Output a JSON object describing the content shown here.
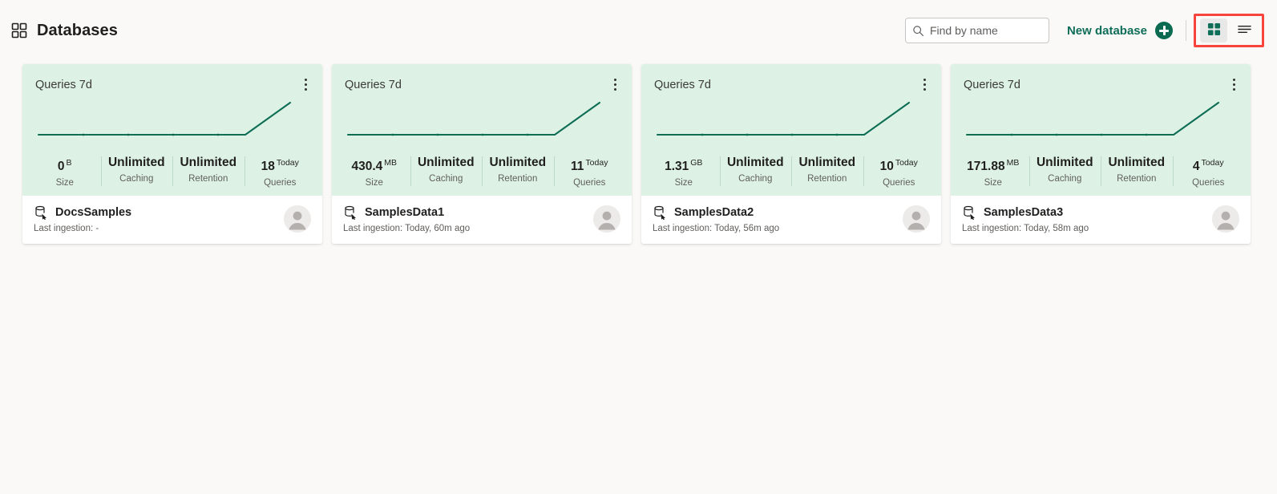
{
  "header": {
    "title": "Databases",
    "title_icon": "grid-squares-icon",
    "search": {
      "icon": "search-icon",
      "placeholder": "Find by name",
      "value": ""
    },
    "new_database": {
      "label": "New database",
      "icon": "plus-circle-icon"
    },
    "view_toggle": {
      "highlighted": true,
      "highlight_color": "#f8443c",
      "options": [
        {
          "name": "grid-view",
          "icon": "grid-view-icon",
          "selected": true
        },
        {
          "name": "list-view",
          "icon": "list-view-icon",
          "selected": false
        }
      ]
    }
  },
  "colors": {
    "page_background": "#faf9f8",
    "card_top_background": "#ddf2e5",
    "accent_green": "#0f6e58",
    "sparkline": "#0e6e55",
    "highlight_red": "#f8443c"
  },
  "stat_labels": {
    "size": "Size",
    "caching": "Caching",
    "retention": "Retention",
    "queries": "Queries"
  },
  "cards": [
    {
      "chart_title": "Queries 7d",
      "menu_icon": "kebab-menu-icon",
      "size_value": "0",
      "size_unit": "B",
      "caching_value": "Unlimited",
      "retention_value": "Unlimited",
      "queries_value": "18",
      "queries_unit": "Today",
      "db_icon": "database-icon",
      "db_name": "DocsSamples",
      "last_ingestion": "Last ingestion: -",
      "avatar_icon": "person-avatar-icon"
    },
    {
      "chart_title": "Queries 7d",
      "menu_icon": "kebab-menu-icon",
      "size_value": "430.4",
      "size_unit": "MB",
      "caching_value": "Unlimited",
      "retention_value": "Unlimited",
      "queries_value": "11",
      "queries_unit": "Today",
      "db_icon": "database-icon",
      "db_name": "SamplesData1",
      "last_ingestion": "Last ingestion: Today, 60m ago",
      "avatar_icon": "person-avatar-icon"
    },
    {
      "chart_title": "Queries 7d",
      "menu_icon": "kebab-menu-icon",
      "size_value": "1.31",
      "size_unit": "GB",
      "caching_value": "Unlimited",
      "retention_value": "Unlimited",
      "queries_value": "10",
      "queries_unit": "Today",
      "db_icon": "database-icon",
      "db_name": "SamplesData2",
      "last_ingestion": "Last ingestion: Today, 56m ago",
      "avatar_icon": "person-avatar-icon"
    },
    {
      "chart_title": "Queries 7d",
      "menu_icon": "kebab-menu-icon",
      "size_value": "171.88",
      "size_unit": "MB",
      "caching_value": "Unlimited",
      "retention_value": "Unlimited",
      "queries_value": "4",
      "queries_unit": "Today",
      "db_icon": "database-icon",
      "db_name": "SamplesData3",
      "last_ingestion": "Last ingestion: Today, 58m ago",
      "avatar_icon": "person-avatar-icon"
    }
  ],
  "chart_data": [
    {
      "type": "line",
      "title": "Queries 7d",
      "x": [
        1,
        2,
        3,
        4,
        5,
        6,
        7
      ],
      "values": [
        0,
        0,
        0,
        0,
        0,
        0,
        18
      ],
      "xlabel": "",
      "ylabel": "",
      "grid": false,
      "legend": "none",
      "series_color": "#0e6e55"
    },
    {
      "type": "line",
      "title": "Queries 7d",
      "x": [
        1,
        2,
        3,
        4,
        5,
        6,
        7
      ],
      "values": [
        0,
        0,
        0,
        0,
        0,
        0,
        11
      ],
      "xlabel": "",
      "ylabel": "",
      "grid": false,
      "legend": "none",
      "series_color": "#0e6e55"
    },
    {
      "type": "line",
      "title": "Queries 7d",
      "x": [
        1,
        2,
        3,
        4,
        5,
        6,
        7
      ],
      "values": [
        0,
        0,
        0,
        0,
        0,
        0,
        10
      ],
      "xlabel": "",
      "ylabel": "",
      "grid": false,
      "legend": "none",
      "series_color": "#0e6e55"
    },
    {
      "type": "line",
      "title": "Queries 7d",
      "x": [
        1,
        2,
        3,
        4,
        5,
        6,
        7
      ],
      "values": [
        0,
        0,
        0,
        0,
        0,
        0,
        4
      ],
      "xlabel": "",
      "ylabel": "",
      "grid": false,
      "legend": "none",
      "series_color": "#0e6e55"
    }
  ]
}
